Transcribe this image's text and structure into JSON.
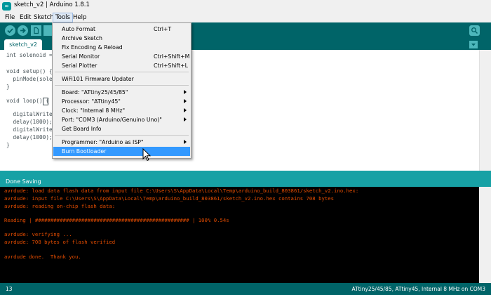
{
  "window": {
    "title": "sketch_v2 | Arduino 1.8.1",
    "icon": "arduino-logo-icon"
  },
  "menubar": {
    "items": [
      "File",
      "Edit",
      "Sketch",
      "Tools",
      "Help"
    ]
  },
  "toolbar": {
    "icons": [
      "verify-icon",
      "upload-icon",
      "new-icon",
      "open-icon",
      "save-icon",
      "serial-monitor-icon"
    ]
  },
  "tabs": [
    {
      "label": "sketch_v2"
    }
  ],
  "editor": {
    "lines": [
      "int solenoid = ",
      "",
      "void setup() {",
      "  pinMode(solen",
      "}",
      "",
      "void loop() {",
      "",
      "  digitalWrite(",
      "  delay(1000);",
      "  digitalWrite(",
      "  delay(1000);",
      "}"
    ]
  },
  "status": {
    "text": "Done Saving"
  },
  "console": {
    "lines": [
      "avrdude: load data flash data from input file C:\\Users\\S\\AppData\\Local\\Temp\\arduino_build_803861/sketch_v2.ino.hex:",
      "avrdude: input file C:\\Users\\S\\AppData\\Local\\Temp\\arduino_build_803861/sketch_v2.ino.hex contains 708 bytes",
      "avrdude: reading on-chip flash data:",
      "",
      "Reading | ################################################## | 100% 0.54s",
      "",
      "avrdude: verifying ...",
      "avrdude: 708 bytes of flash verified",
      "",
      "avrdude done.  Thank you."
    ]
  },
  "bottom": {
    "line_number": "13",
    "board_info": "ATtiny25/45/85, ATtiny45, Internal 8 MHz on COM3"
  },
  "tools_menu": {
    "auto_format": {
      "label": "Auto Format",
      "shortcut": "Ctrl+T"
    },
    "archive_sketch": {
      "label": "Archive Sketch"
    },
    "fix_encoding": {
      "label": "Fix Encoding & Reload"
    },
    "serial_monitor": {
      "label": "Serial Monitor",
      "shortcut": "Ctrl+Shift+M"
    },
    "serial_plotter": {
      "label": "Serial Plotter",
      "shortcut": "Ctrl+Shift+L"
    },
    "wifi_updater": {
      "label": "WiFi101 Firmware Updater"
    },
    "board": {
      "label": "Board: \"ATtiny25/45/85\""
    },
    "processor": {
      "label": "Processor: \"ATtiny45\""
    },
    "clock": {
      "label": "Clock: \"Internal 8 MHz\""
    },
    "port": {
      "label": "Port: \"COM3 (Arduino/Genuino Uno)\""
    },
    "board_info": {
      "label": "Get Board Info"
    },
    "programmer": {
      "label": "Programmer: \"Arduino as ISP\""
    },
    "burn_bootloader": {
      "label": "Burn Bootloader"
    }
  },
  "colors": {
    "teal": "#006468",
    "light_teal": "#17a1a5",
    "console_text": "#e34c00",
    "highlight": "#3399ff"
  }
}
